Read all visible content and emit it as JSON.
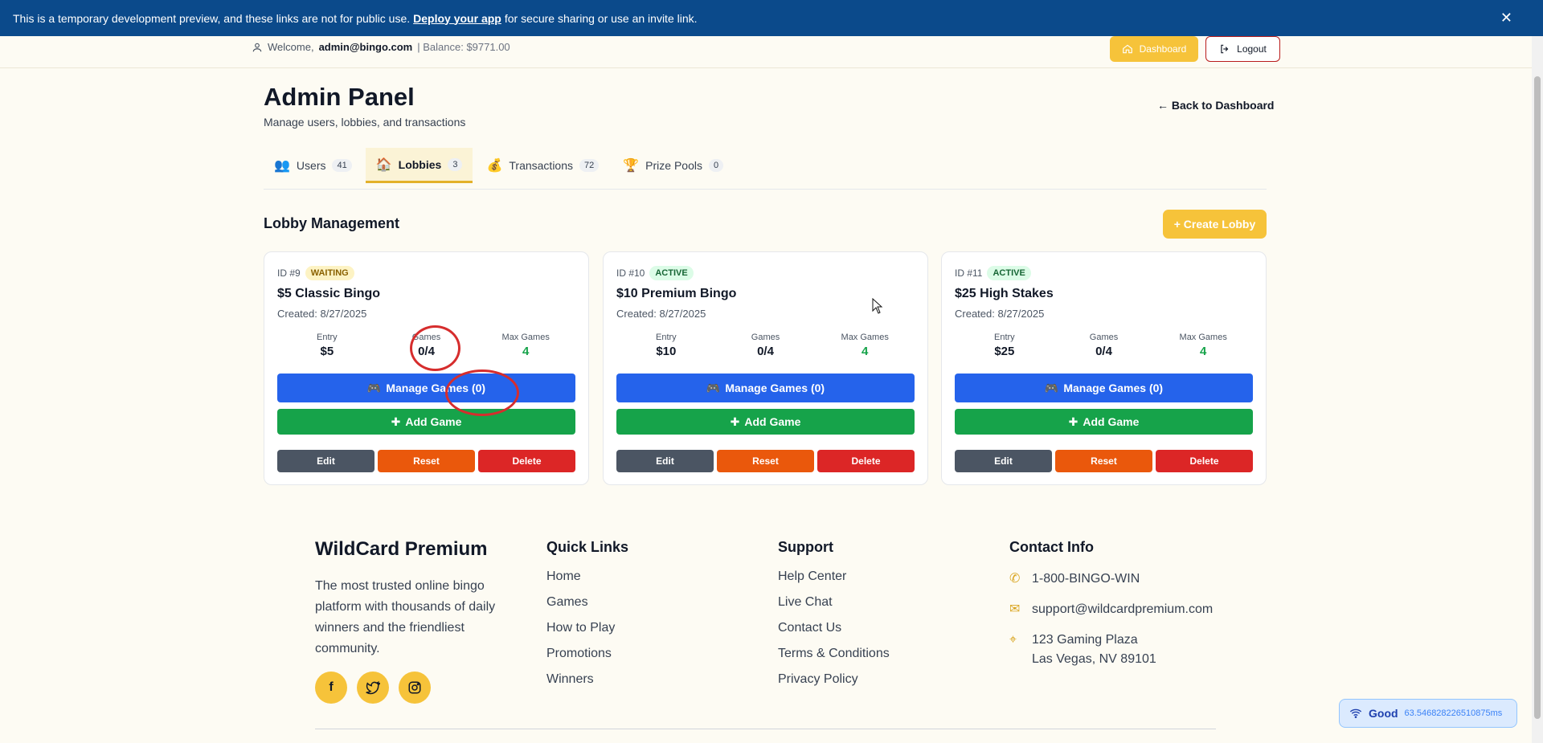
{
  "banner": {
    "text_before": "This is a temporary development preview, and these links are not for public use.",
    "link": "Deploy your app",
    "text_after": "for secure sharing or use an invite link.",
    "close": "✕"
  },
  "header": {
    "welcome": "Welcome,",
    "email": "admin@bingo.com",
    "balance": "| Balance: $9771.00",
    "dashboard": "Dashboard",
    "logout": "Logout"
  },
  "page": {
    "title": "Admin Panel",
    "subtitle": "Manage users, lobbies, and transactions",
    "back": "← Back to Dashboard"
  },
  "tabs": [
    {
      "label": "Users",
      "count": "41",
      "icon": "users-icon"
    },
    {
      "label": "Lobbies",
      "count": "3",
      "icon": "home-icon"
    },
    {
      "label": "Transactions",
      "count": "72",
      "icon": "money-bag-icon"
    },
    {
      "label": "Prize Pools",
      "count": "0",
      "icon": "trophy-icon"
    }
  ],
  "section": {
    "title": "Lobby Management",
    "create": "+ Create Lobby"
  },
  "lobbies": [
    {
      "id": "ID #9",
      "status": "WAITING",
      "name": "$5 Classic Bingo",
      "created": "Created: 8/27/2025",
      "entry_label": "Entry",
      "entry": "$5",
      "games_label": "Games",
      "games": "0/4",
      "max_label": "Max Games",
      "max": "4",
      "manage": "Manage Games (0)",
      "add": "Add Game",
      "edit": "Edit",
      "reset": "Reset",
      "delete": "Delete"
    },
    {
      "id": "ID #10",
      "status": "ACTIVE",
      "name": "$10 Premium Bingo",
      "created": "Created: 8/27/2025",
      "entry_label": "Entry",
      "entry": "$10",
      "games_label": "Games",
      "games": "0/4",
      "max_label": "Max Games",
      "max": "4",
      "manage": "Manage Games (0)",
      "add": "Add Game",
      "edit": "Edit",
      "reset": "Reset",
      "delete": "Delete"
    },
    {
      "id": "ID #11",
      "status": "ACTIVE",
      "name": "$25 High Stakes",
      "created": "Created: 8/27/2025",
      "entry_label": "Entry",
      "entry": "$25",
      "games_label": "Games",
      "games": "0/4",
      "max_label": "Max Games",
      "max": "4",
      "manage": "Manage Games (0)",
      "add": "Add Game",
      "edit": "Edit",
      "reset": "Reset",
      "delete": "Delete"
    }
  ],
  "footer": {
    "brand": "WildCard Premium",
    "description": "The most trusted online bingo platform with thousands of daily winners and the friendliest community.",
    "quick_title": "Quick Links",
    "quick_links": [
      "Home",
      "Games",
      "How to Play",
      "Promotions",
      "Winners"
    ],
    "support_title": "Support",
    "support_links": [
      "Help Center",
      "Live Chat",
      "Contact Us",
      "Terms & Conditions",
      "Privacy Policy"
    ],
    "contact_title": "Contact Info",
    "phone": "1-800-BINGO-WIN",
    "email": "support@wildcardpremium.com",
    "address1": "123 Gaming Plaza",
    "address2": "Las Vegas, NV 89101"
  },
  "network": {
    "label": "Good",
    "latency": "63.546828226510875ms"
  },
  "colors": {
    "banner": "#0b4a8b",
    "accent": "#f6c33a",
    "primary": "#2563eb",
    "success": "#16a34a",
    "danger": "#dc2626",
    "warning": "#ea580c"
  }
}
